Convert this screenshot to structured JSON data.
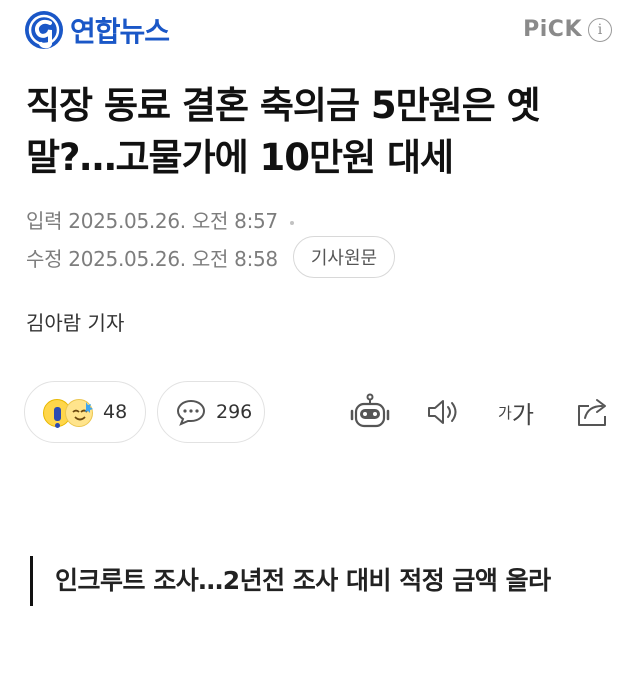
{
  "header": {
    "logo_text": "연합뉴스",
    "pick_label": "PiCK",
    "info_icon": "info-icon"
  },
  "article": {
    "title": "직장 동료 결혼 축의금 5만원은 옛말?…고물가에 10만원 대세",
    "published_label": "입력",
    "published": "2025.05.26. 오전 8:57",
    "modified_label": "수정",
    "modified": "2025.05.26. 오전 8:58",
    "original_button": "기사원문",
    "reporter": "김아람 기자",
    "subheading": "인크루트 조사…2년전 조사 대비 적정 금액 올라"
  },
  "actions": {
    "reaction_count": "48",
    "comment_count": "296",
    "font_small": "가",
    "font_large": "가",
    "icons": [
      "reaction-emoji-icon",
      "comment-bubble-icon",
      "robot-summary-icon",
      "speaker-icon",
      "font-size-icon",
      "share-icon"
    ]
  },
  "colors": {
    "brand_blue": "#1a57c7",
    "muted_text": "#7d7d7d"
  }
}
